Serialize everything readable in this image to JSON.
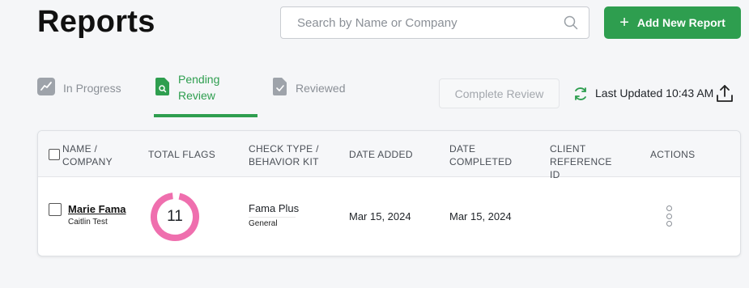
{
  "header": {
    "title": "Reports",
    "search_placeholder": "Search by Name or Company",
    "search_icon": "search-icon",
    "add_button_label": "Add New Report",
    "add_button_icon": "plus-icon"
  },
  "tabs": [
    {
      "label": "In Progress",
      "icon": "chart-icon",
      "active": false
    },
    {
      "label": "Pending Review",
      "icon": "document-search-icon",
      "active": true
    },
    {
      "label": "Reviewed",
      "icon": "document-check-icon",
      "active": false
    }
  ],
  "toolbar": {
    "complete_review_label": "Complete Review",
    "last_updated": "Last Updated 10:43 AM",
    "refresh_icon": "refresh-icon",
    "export_icon": "upload-icon"
  },
  "table": {
    "columns": [
      "NAME / COMPANY",
      "TOTAL FLAGS",
      "CHECK TYPE / BEHAVIOR KIT",
      "DATE ADDED",
      "DATE COMPLETED",
      "CLIENT REFERENCE ID",
      "ACTIONS"
    ],
    "rows": [
      {
        "name": "Marie Fama",
        "company": "Caitlin Test",
        "total_flags": "11",
        "check_type": "Fama Plus",
        "behavior_kit": "General",
        "date_added": "Mar 15, 2024",
        "date_completed": "Mar 15, 2024",
        "client_reference_id": "",
        "actions_icon": "more-vertical-icon"
      }
    ]
  },
  "colors": {
    "brand_green": "#2e9e4f",
    "flag_pink": "#ef6fae",
    "muted_text": "#8a8f96"
  }
}
